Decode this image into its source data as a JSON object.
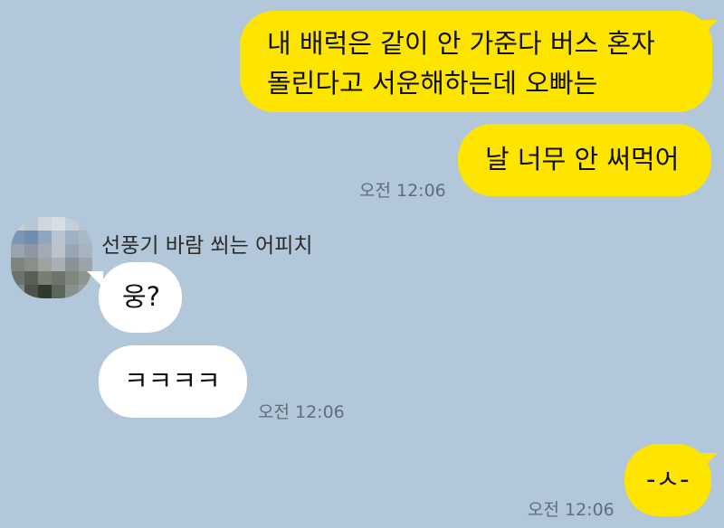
{
  "colors": {
    "background": "#b2c7d9",
    "my_bubble": "#fee500",
    "their_bubble": "#ffffff",
    "timestamp": "#5f6e7a"
  },
  "messages": [
    {
      "side": "me",
      "lines": [
        "내 배럭은 같이 안 가준다 버스 혼자",
        "돌린다고 서운해하는데 오빠는"
      ]
    },
    {
      "side": "me",
      "text": "날 너무 안 써먹어",
      "time": "오전 12:06"
    },
    {
      "side": "other",
      "sender": "선풍기 바람 쐬는 어피치",
      "avatar": "pixelated-profile-picture",
      "text": "웅?"
    },
    {
      "side": "other",
      "text": "ㅋㅋㅋㅋ",
      "time": "오전 12:06"
    },
    {
      "side": "me",
      "text": "-ㅅ-",
      "time": "오전 12:06"
    }
  ]
}
